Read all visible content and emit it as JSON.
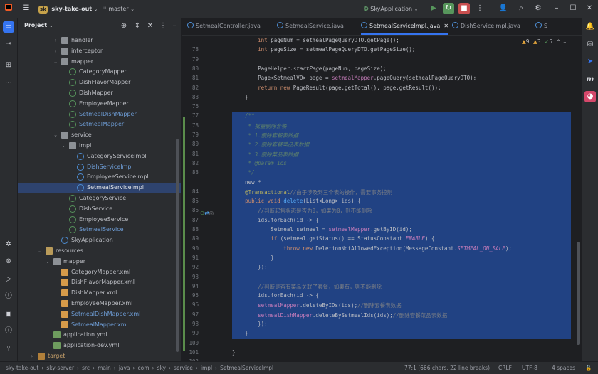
{
  "topbar": {
    "project_badge": "sk",
    "project_name": "sky-take-out",
    "branch": "master",
    "run_config": "SkyApplication"
  },
  "project_panel": {
    "title": "Project",
    "tree": [
      {
        "label": "handler",
        "type": "folder",
        "depth": 5,
        "arrow": "›"
      },
      {
        "label": "interceptor",
        "type": "folder",
        "depth": 5,
        "arrow": "›"
      },
      {
        "label": "mapper",
        "type": "folder",
        "depth": 5,
        "arrow": "⌄"
      },
      {
        "label": "CategoryMapper",
        "type": "iface",
        "depth": 6
      },
      {
        "label": "DishFlavorMapper",
        "type": "iface",
        "depth": 6
      },
      {
        "label": "DishMapper",
        "type": "iface",
        "depth": 6
      },
      {
        "label": "EmployeeMapper",
        "type": "iface",
        "depth": 6
      },
      {
        "label": "SetmealDishMapper",
        "type": "iface",
        "depth": 6,
        "color": "#6e9dd6"
      },
      {
        "label": "SetmealMapper",
        "type": "iface",
        "depth": 6,
        "color": "#6e9dd6"
      },
      {
        "label": "service",
        "type": "folder",
        "depth": 5,
        "arrow": "⌄"
      },
      {
        "label": "impl",
        "type": "folder",
        "depth": 6,
        "arrow": "⌄"
      },
      {
        "label": "CategoryServiceImpl",
        "type": "class",
        "depth": 7
      },
      {
        "label": "DishServiceImpl",
        "type": "class",
        "depth": 7,
        "color": "#6e9dd6"
      },
      {
        "label": "EmployeeServiceImpl",
        "type": "class",
        "depth": 7
      },
      {
        "label": "SetmealServiceImpl",
        "type": "class",
        "depth": 7,
        "selected": true
      },
      {
        "label": "CategoryService",
        "type": "iface",
        "depth": 6
      },
      {
        "label": "DishService",
        "type": "iface",
        "depth": 6
      },
      {
        "label": "EmployeeService",
        "type": "iface",
        "depth": 6
      },
      {
        "label": "SetmealService",
        "type": "iface",
        "depth": 6,
        "color": "#6e9dd6"
      },
      {
        "label": "SkyApplication",
        "type": "class",
        "depth": 5
      },
      {
        "label": "resources",
        "type": "res",
        "depth": 3,
        "arrow": "⌄"
      },
      {
        "label": "mapper",
        "type": "folder",
        "depth": 4,
        "arrow": "⌄"
      },
      {
        "label": "CategoryMapper.xml",
        "type": "xml",
        "depth": 5
      },
      {
        "label": "DishFlavorMapper.xml",
        "type": "xml",
        "depth": 5
      },
      {
        "label": "DishMapper.xml",
        "type": "xml",
        "depth": 5
      },
      {
        "label": "EmployeeMapper.xml",
        "type": "xml",
        "depth": 5
      },
      {
        "label": "SetmealDishMapper.xml",
        "type": "xml",
        "depth": 5,
        "color": "#6e9dd6"
      },
      {
        "label": "SetmealMapper.xml",
        "type": "xml",
        "depth": 5,
        "color": "#6e9dd6"
      },
      {
        "label": "application.yml",
        "type": "yml",
        "depth": 4
      },
      {
        "label": "application-dev.yml",
        "type": "yml",
        "depth": 4
      },
      {
        "label": "target",
        "type": "folder-target",
        "depth": 2,
        "arrow": "›",
        "color": "#c9a26b"
      }
    ]
  },
  "tabs": [
    {
      "label": "SetmealController.java"
    },
    {
      "label": "SetmealService.java"
    },
    {
      "label": "SetmealServiceImpl.java",
      "active": true
    },
    {
      "label": "DishServiceImpl.java"
    },
    {
      "label": "S"
    }
  ],
  "inspections": {
    "warnings": "9",
    "weak": "3",
    "typos": "5"
  },
  "code_lines": [
    {
      "n": "",
      "html": "        <span class=\"kw\">int</span> pageNum = setmealPageQueryDTO.getPage();"
    },
    {
      "n": "78",
      "html": "        <span class=\"kw\">int</span> pageSize = setmealPageQueryDTO.getPageSize();"
    },
    {
      "n": "79",
      "html": ""
    },
    {
      "n": "80",
      "html": "        PageHelper.<i>startPage</i>(pageNum, pageSize);"
    },
    {
      "n": "81",
      "html": "        Page&lt;SetmealVO&gt; page = <span class=\"fld\">setmealMapper</span>.pageQuery(setmealPageQueryDTO);"
    },
    {
      "n": "82",
      "html": "        <span class=\"kw\">return new</span> PageResult(page.getTotal(), page.getResult());"
    },
    {
      "n": "83",
      "html": "    }"
    },
    {
      "n": "76",
      "html": ""
    },
    {
      "n": "77",
      "html": "    <span class=\"jd\">/**</span>",
      "sel": true
    },
    {
      "n": "78",
      "html": "<span class=\"jd\">     * 批量删除套餐</span>",
      "sel": true
    },
    {
      "n": "79",
      "html": "<span class=\"jd\">     * 1.删除套餐表数据</span>",
      "sel": true
    },
    {
      "n": "80",
      "html": "<span class=\"jd\">     * 2.删除套餐菜品表数据</span>",
      "sel": true
    },
    {
      "n": "81",
      "html": "<span class=\"jd\">     * 3.删除菜品表数据</span>",
      "sel": true
    },
    {
      "n": "82",
      "html": "<span class=\"jd\">     * @param <u>ids</u></span>",
      "sel": true
    },
    {
      "n": "83",
      "html": "<span class=\"jd\">     */</span>",
      "sel": true
    },
    {
      "n": "",
      "html": "    new *",
      "sel": true
    },
    {
      "n": "84",
      "html": "    <span class=\"ann\">@Transactional</span><span class=\"cmt\">//由于涉及到三个表的操作，需要事务控制</span>",
      "sel": true
    },
    {
      "n": "85",
      "html": "    <span class=\"kw\">public void</span> <span class=\"fn\">delete</span>(List&lt;Long&gt; ids) {",
      "sel": true
    },
    {
      "n": "86",
      "html": "        <span class=\"cmt\">//判断起售状态是否为0，如果为0，则不能删除</span>",
      "sel": true
    },
    {
      "n": "87",
      "html": "        ids.forEach(id -&gt; {",
      "sel": true
    },
    {
      "n": "88",
      "html": "            Setmeal setmeal = <span class=\"fld\">setmealMapper</span>.getByID(id);",
      "sel": true
    },
    {
      "n": "89",
      "html": "            <span class=\"kw\">if</span> (setmeal.getStatus() == StatusConstant.<span class=\"const\">ENABLE</span>) {",
      "sel": true
    },
    {
      "n": "90",
      "html": "                <span class=\"kw\">throw new</span> DeletionNotAllowedException(MessageConstant.<span class=\"const\">SETMEAL_ON_SALE</span>);",
      "sel": true
    },
    {
      "n": "91",
      "html": "            }",
      "sel": true
    },
    {
      "n": "92",
      "html": "        });",
      "sel": true
    },
    {
      "n": "93",
      "html": "",
      "sel": true
    },
    {
      "n": "94",
      "html": "        <span class=\"cmt\">//判断是否有菜品关联了套餐，如果有，则不能删除</span>",
      "sel": true
    },
    {
      "n": "95",
      "html": "        ids.forEach(id -&gt; {",
      "sel": true
    },
    {
      "n": "96",
      "html": "        <span class=\"fld\">setmealMapper</span>.deleteByIDs(ids);<span class=\"cmt\">//删除套餐表数据</span>",
      "sel": true
    },
    {
      "n": "97",
      "html": "        <span class=\"fld\">setmealDishMapper</span>.deleteBySetmealIds(ids);<span class=\"cmt\">//删除套餐菜品表数据</span>",
      "sel": true
    },
    {
      "n": "98",
      "html": "        });",
      "sel": true
    },
    {
      "n": "99",
      "html": "    }",
      "sel": true
    },
    {
      "n": "100",
      "html": ""
    },
    {
      "n": "101",
      "html": "}"
    },
    {
      "n": "102",
      "html": ""
    }
  ],
  "statusbar": {
    "crumbs": [
      "sky-take-out",
      "sky-server",
      "src",
      "main",
      "java",
      "com",
      "sky",
      "service",
      "impl",
      "SetmealServiceImpl"
    ],
    "position": "77:1 (666 chars, 22 line breaks)",
    "line_sep": "CRLF",
    "encoding": "UTF-8",
    "indent": "4 spaces"
  }
}
